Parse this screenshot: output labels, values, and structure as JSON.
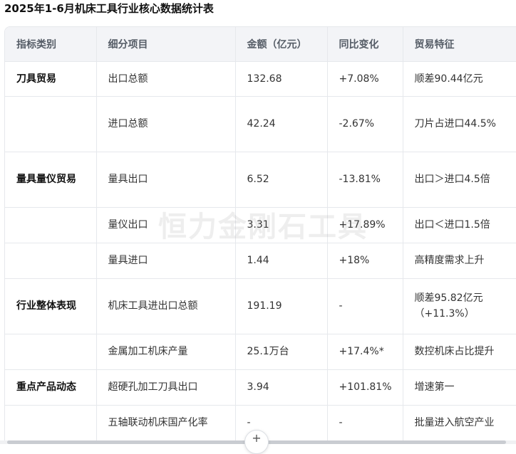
{
  "title": "2025年1-6月机床工具行业核心数据统计表",
  "table": {
    "headers": [
      "指标类别",
      "细分项目",
      "金额（亿元）",
      "同比变化",
      "贸易特征"
    ],
    "rows": [
      [
        "刀具贸易",
        "出口总额",
        "132.68",
        "+7.08%",
        "顺差90.44亿元"
      ],
      [
        "",
        "进口总额",
        "42.24",
        "-2.67%",
        "刀片占进口44.5%"
      ],
      [
        "量具量仪贸易",
        "量具出口",
        "6.52",
        "-13.81%",
        "出口＞进口4.5倍"
      ],
      [
        "",
        "量仪出口",
        "3.31",
        "+17.89%",
        "出口＜进口1.5倍"
      ],
      [
        "",
        "量具进口",
        "1.44",
        "+18%",
        "高精度需求上升"
      ],
      [
        "行业整体表现",
        "机床工具进出口总额",
        "191.19",
        "-",
        "顺差95.82亿元（+11.3%）"
      ],
      [
        "",
        "金属加工机床产量",
        "25.1万台",
        "+17.4%*",
        "数控机床占比提升"
      ],
      [
        "重点产品动态",
        "超硬孔加工刀具出口",
        "3.94",
        "+101.81%",
        "增速第一"
      ],
      [
        "",
        "五轴联动机床国产化率",
        "-",
        "-",
        "批量进入航空产业"
      ]
    ]
  },
  "watermark": "恒力金刚石工具",
  "scroll_button_icon": "plus-icon",
  "scroll_button_glyph": "+"
}
